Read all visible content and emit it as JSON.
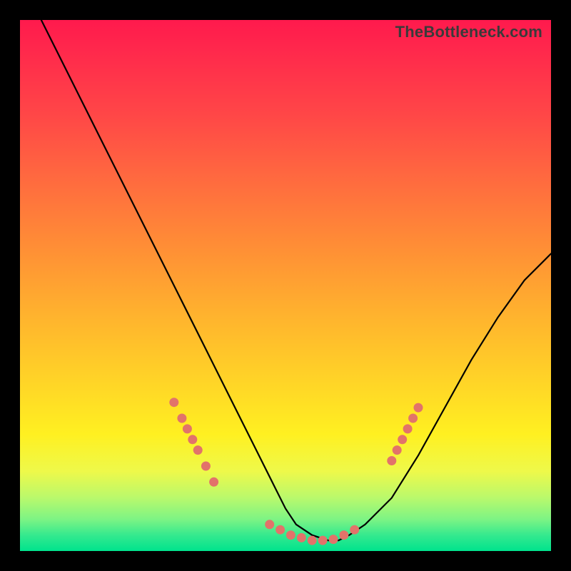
{
  "watermark": "TheBottleneck.com",
  "chart_data": {
    "type": "line",
    "title": "",
    "xlabel": "",
    "ylabel": "",
    "xlim": [
      0,
      100
    ],
    "ylim": [
      0,
      100
    ],
    "grid": false,
    "legend": false,
    "series": [
      {
        "name": "curve",
        "color": "#000000",
        "x": [
          4,
          10,
          15,
          20,
          25,
          30,
          35,
          40,
          45,
          48,
          50,
          52,
          55,
          58,
          60,
          62,
          65,
          70,
          75,
          80,
          85,
          90,
          95,
          100
        ],
        "y": [
          100,
          88,
          78,
          68,
          58,
          48,
          38,
          28,
          18,
          12,
          8,
          5,
          3,
          2,
          2,
          3,
          5,
          10,
          18,
          27,
          36,
          44,
          51,
          56
        ]
      }
    ],
    "markers": [
      {
        "name": "points-left",
        "color": "#e2736a",
        "x": [
          29,
          30.5,
          31.5,
          32.5,
          33.5,
          35,
          36.5
        ],
        "y": [
          28,
          25,
          23,
          21,
          19,
          16,
          13
        ]
      },
      {
        "name": "points-bottom",
        "color": "#e2736a",
        "x": [
          47,
          49,
          51,
          53,
          55,
          57,
          59,
          61,
          63
        ],
        "y": [
          5,
          4,
          3,
          2.5,
          2,
          2,
          2.2,
          3,
          4
        ]
      },
      {
        "name": "points-right",
        "color": "#e2736a",
        "x": [
          70,
          71,
          72,
          73,
          74,
          75
        ],
        "y": [
          17,
          19,
          21,
          23,
          25,
          27
        ]
      }
    ]
  }
}
